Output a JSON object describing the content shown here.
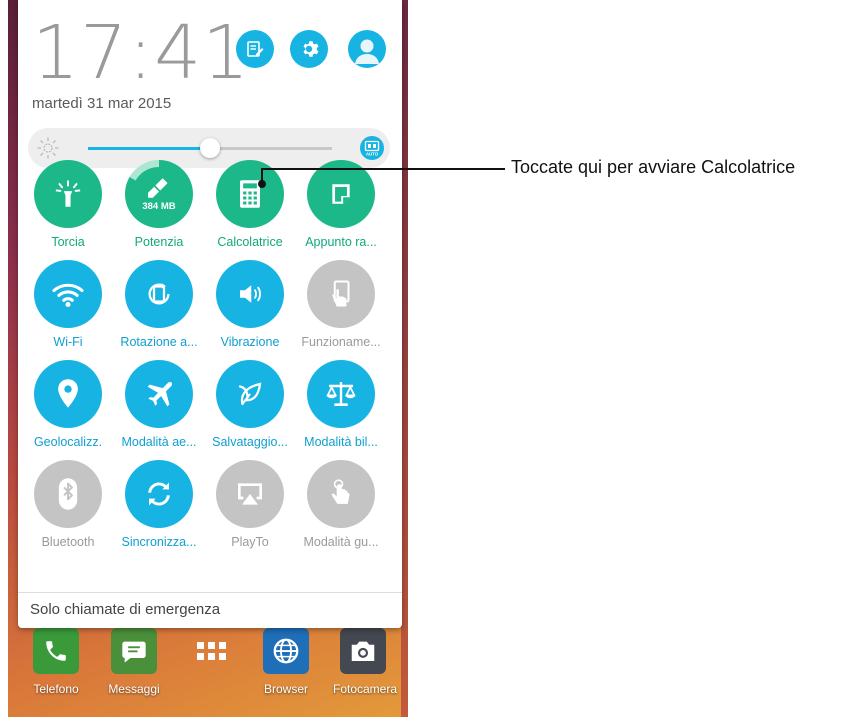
{
  "status": {
    "time": "17:41",
    "date": "martedì 31 mar 2015"
  },
  "header_buttons": [
    {
      "icon": "edit-icon"
    },
    {
      "icon": "settings-icon"
    },
    {
      "icon": "avatar-icon"
    }
  ],
  "brightness": {
    "level": 0.5,
    "auto_label": "AUTO"
  },
  "tiles": [
    {
      "label": "Torcia",
      "icon": "flashlight-icon",
      "state": "on",
      "badge": ""
    },
    {
      "label": "Potenzia",
      "icon": "boost-icon",
      "state": "on",
      "badge": "384 MB"
    },
    {
      "label": "Calcolatrice",
      "icon": "calculator-icon",
      "state": "on",
      "badge": ""
    },
    {
      "label": "Appunto ra...",
      "icon": "quick-memo-icon",
      "state": "on",
      "badge": ""
    },
    {
      "label": "Wi-Fi",
      "icon": "wifi-icon",
      "state": "active",
      "badge": ""
    },
    {
      "label": "Rotazione a...",
      "icon": "rotation-icon",
      "state": "active",
      "badge": ""
    },
    {
      "label": "Vibrazione",
      "icon": "vibration-icon",
      "state": "active",
      "badge": ""
    },
    {
      "label": "Funzioname...",
      "icon": "one-hand-icon",
      "state": "off",
      "badge": ""
    },
    {
      "label": "Geolocalizz.",
      "icon": "location-icon",
      "state": "active",
      "badge": ""
    },
    {
      "label": "Modalità ae...",
      "icon": "airplane-icon",
      "state": "active",
      "badge": ""
    },
    {
      "label": "Salvataggio...",
      "icon": "power-saving-icon",
      "state": "active",
      "badge": ""
    },
    {
      "label": "Modalità bil...",
      "icon": "balance-icon",
      "state": "active",
      "badge": ""
    },
    {
      "label": "Bluetooth",
      "icon": "bluetooth-icon",
      "state": "off",
      "badge": ""
    },
    {
      "label": "Sincronizza...",
      "icon": "sync-icon",
      "state": "active",
      "badge": ""
    },
    {
      "label": "PlayTo",
      "icon": "playto-icon",
      "state": "off",
      "badge": ""
    },
    {
      "label": "Modalità gu...",
      "icon": "glove-mode-icon",
      "state": "off",
      "badge": ""
    }
  ],
  "footer": {
    "text": "Solo chiamate di emergenza"
  },
  "dock": [
    {
      "label": "Telefono",
      "icon": "phone-icon"
    },
    {
      "label": "Messaggi",
      "icon": "messages-icon"
    },
    {
      "label": "",
      "icon": "app-drawer-icon"
    },
    {
      "label": "Browser",
      "icon": "browser-icon"
    },
    {
      "label": "Fotocamera",
      "icon": "camera-icon"
    }
  ],
  "callout": {
    "text": "Toccate qui per avviare Calcolatrice"
  },
  "colors": {
    "green": "#1db889",
    "blue": "#17b4e3",
    "gray": "#c4c4c4",
    "label_green": "#12a87c",
    "label_blue": "#0f9fd0",
    "label_gray": "#9a9a9a"
  }
}
